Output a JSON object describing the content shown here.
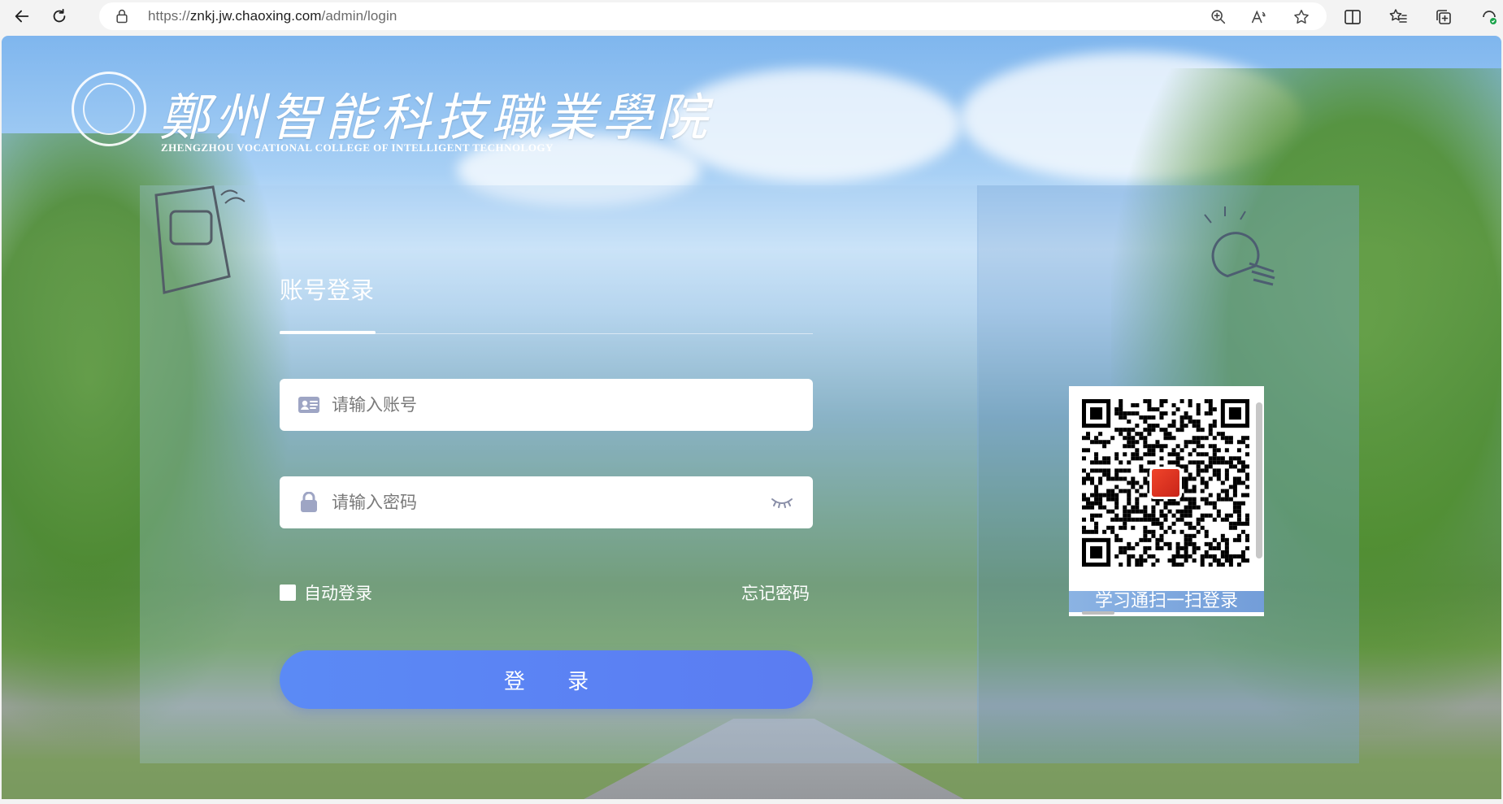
{
  "browser": {
    "url_prefix": "https://",
    "url_host": "znkj.jw.chaoxing.com",
    "url_path": "/admin/login",
    "icons": [
      "back-icon",
      "reload-icon",
      "lock-icon",
      "zoom-icon",
      "read-aloud-icon",
      "favorite-star-icon",
      "split-screen-icon",
      "favorites-icon",
      "collections-icon",
      "copilot-icon"
    ]
  },
  "page": {
    "logo_cn": "鄭州智能科技職業學院",
    "logo_en": "ZHENGZHOU VOCATIONAL COLLEGE OF INTELLIGENT TECHNOLOGY",
    "tab_title": "账号登录",
    "account_placeholder": "请输入账号",
    "password_placeholder": "请输入密码",
    "remember_label": "自动登录",
    "forgot_label": "忘记密码",
    "login_button": "登 录",
    "qr_caption": "学习通扫一扫登录"
  },
  "colors": {
    "primary_button": "#5b84f4",
    "panel_right": "#78a5d7"
  }
}
